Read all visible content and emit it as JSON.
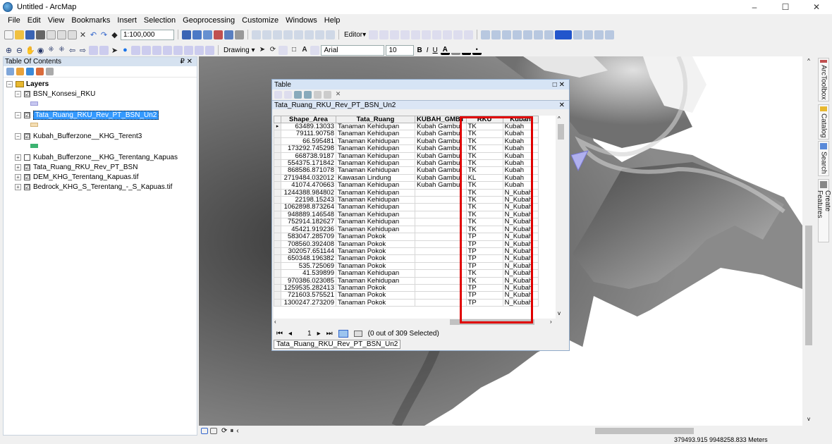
{
  "window": {
    "title": "Untitled - ArcMap",
    "minimize": "–",
    "maximize": "☐",
    "close": "✕"
  },
  "menu": [
    "File",
    "Edit",
    "View",
    "Bookmarks",
    "Insert",
    "Selection",
    "Geoprocessing",
    "Customize",
    "Windows",
    "Help"
  ],
  "toolbar": {
    "scale": "1:100,000",
    "editor": "Editor▾",
    "drawing": "Drawing ▾",
    "font": "Arial",
    "font_size": "10",
    "bold": "B",
    "italic": "I",
    "underline": "U"
  },
  "toc": {
    "header": "Table Of Contents",
    "pin": "₽ ✕",
    "root": "Layers",
    "layers": [
      {
        "name": "BSN_Konsesi_RKU",
        "checked": true,
        "swatch": "#c8c8f0"
      },
      {
        "name": "Tata_Ruang_RKU_Rev_PT_BSN_Un2",
        "checked": true,
        "swatch": "#f5deb3",
        "selected": true
      },
      {
        "name": "Kubah_Bufferzone__KHG_Terent3",
        "checked": true,
        "swatch": "#3cb371"
      },
      {
        "name": "Kubah_Bufferzone__KHG_Terentang_Kapuas",
        "checked": false
      },
      {
        "name": "Tata_Ruang_RKU_Rev_PT_BSN",
        "checked": true
      },
      {
        "name": "DEM_KHG_Terentang_Kapuas.tif",
        "checked": true
      },
      {
        "name": "Bedrock_KHG_S_Terentang_-_S_Kapuas.tif",
        "checked": true
      }
    ]
  },
  "dock": [
    "ArcToolbox",
    "Catalog",
    "Search",
    "Create Features"
  ],
  "table_window": {
    "title": "Table",
    "tab_title": "Tata_Ruang_RKU_Rev_PT_BSN_Un2",
    "columns": [
      "Shape_Area",
      "Tata_Ruang",
      "KUBAH_GMBT",
      "RKU",
      "Kubah"
    ],
    "rows": [
      [
        "63489.13033",
        "Tanaman Kehidupan",
        "Kubah Gambut",
        "TK",
        "Kubah"
      ],
      [
        "79111.90758",
        "Tanaman Kehidupan",
        "Kubah Gambut",
        "TK",
        "Kubah"
      ],
      [
        "66.595481",
        "Tanaman Kehidupan",
        "Kubah Gambut",
        "TK",
        "Kubah"
      ],
      [
        "173292.745298",
        "Tanaman Kehidupan",
        "Kubah Gambut",
        "TK",
        "Kubah"
      ],
      [
        "668738.9187",
        "Tanaman Kehidupan",
        "Kubah Gambut",
        "TK",
        "Kubah"
      ],
      [
        "554375.171842",
        "Tanaman Kehidupan",
        "Kubah Gambut",
        "TK",
        "Kubah"
      ],
      [
        "868586.871078",
        "Tanaman Kehidupan",
        "Kubah Gambut",
        "TK",
        "Kubah"
      ],
      [
        "2719484.032012",
        "Kawasan Lindung",
        "Kubah Gambut",
        "KL",
        "Kubah"
      ],
      [
        "41074.470663",
        "Tanaman Kehidupan",
        "Kubah Gambut",
        "TK",
        "Kubah"
      ],
      [
        "1244388.984802",
        "Tanaman Kehidupan",
        "",
        "TK",
        "N_Kubah"
      ],
      [
        "22198.15243",
        "Tanaman Kehidupan",
        "",
        "TK",
        "N_Kubah"
      ],
      [
        "1062898.873264",
        "Tanaman Kehidupan",
        "",
        "TK",
        "N_Kubah"
      ],
      [
        "948889.146548",
        "Tanaman Kehidupan",
        "",
        "TK",
        "N_Kubah"
      ],
      [
        "752914.182627",
        "Tanaman Kehidupan",
        "",
        "TK",
        "N_Kubah"
      ],
      [
        "45421.919236",
        "Tanaman Kehidupan",
        "",
        "TK",
        "N_Kubah"
      ],
      [
        "583047.285709",
        "Tanaman Pokok",
        "",
        "TP",
        "N_Kubah"
      ],
      [
        "708560.392408",
        "Tanaman Pokok",
        "",
        "TP",
        "N_Kubah"
      ],
      [
        "302057.651144",
        "Tanaman Pokok",
        "",
        "TP",
        "N_Kubah"
      ],
      [
        "650348.196382",
        "Tanaman Pokok",
        "",
        "TP",
        "N_Kubah"
      ],
      [
        "535.725069",
        "Tanaman Pokok",
        "",
        "TP",
        "N_Kubah"
      ],
      [
        "41.539899",
        "Tanaman Kehidupan",
        "",
        "TK",
        "N_Kubah"
      ],
      [
        "970386.023085",
        "Tanaman Kehidupan",
        "",
        "TK",
        "N_Kubah"
      ],
      [
        "1259535.282413",
        "Tanaman Pokok",
        "",
        "TP",
        "N_Kubah"
      ],
      [
        "721603.575521",
        "Tanaman Pokok",
        "",
        "TP",
        "N_Kubah"
      ],
      [
        "1300247.273209",
        "Tanaman Pokok",
        "",
        "TP",
        "N_Kubah"
      ]
    ],
    "page": "1",
    "selection_status": "(0 out of 309 Selected)"
  },
  "status": {
    "coordinates": "379493.915  9948258.833 Meters"
  },
  "colors": {
    "highlight_box": "#e00000",
    "toc_selection": "#3399ff"
  }
}
